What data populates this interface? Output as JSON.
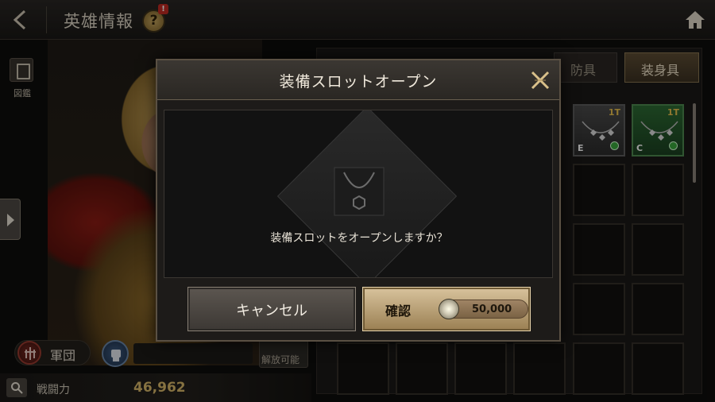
{
  "header": {
    "title": "英雄情報",
    "help_label": "?",
    "help_badge": "!"
  },
  "left_panel": {
    "book_label": "図鑑",
    "legion_label": "軍団",
    "combat_power_label": "戦闘力",
    "combat_power_value": "46,962",
    "unlock_label": "解放可能"
  },
  "inventory": {
    "tabs": [
      {
        "label": "防具",
        "active": false
      },
      {
        "label": "装身具",
        "active": true
      }
    ],
    "filled_slots": [
      {
        "tier": "1T",
        "grade": "E",
        "color": "grey",
        "equipped": true
      },
      {
        "tier": "1T",
        "grade": "C",
        "color": "green",
        "equipped": true
      }
    ]
  },
  "modal": {
    "title": "装備スロットオープン",
    "message": "装備スロットをオープンしますか？",
    "cancel_label": "キャンセル",
    "confirm_label": "確認",
    "cost_value": "50,000",
    "cost_icon": "silver-coin-icon"
  },
  "colors": {
    "accent_gold": "#d8b86a",
    "confirm_button": "#c9b088",
    "cancel_button": "#4d4843",
    "badge_red": "#c22a22"
  }
}
